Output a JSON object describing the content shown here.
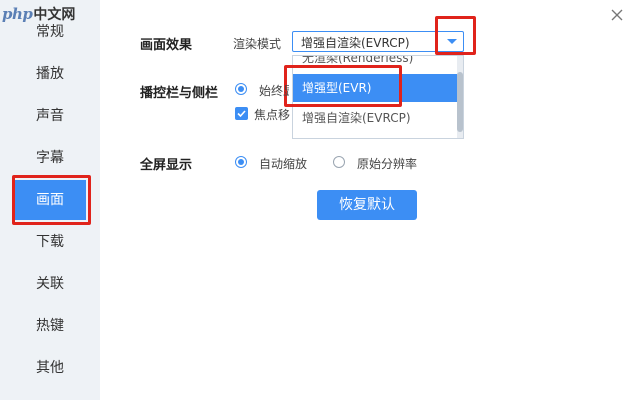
{
  "logo": {
    "php": "php",
    "cn": "中文网"
  },
  "sidebar": {
    "items": [
      {
        "label": "常规"
      },
      {
        "label": "播放"
      },
      {
        "label": "声音"
      },
      {
        "label": "字幕"
      },
      {
        "label": "画面"
      },
      {
        "label": "下载"
      },
      {
        "label": "关联"
      },
      {
        "label": "热键"
      },
      {
        "label": "其他"
      }
    ],
    "active_index": 4
  },
  "picture": {
    "label": "画面效果",
    "render_mode_label": "渲染模式",
    "render_mode_value": "增强自渲染(EVRCP)",
    "options": [
      {
        "label": "无渲染(Renderless)"
      },
      {
        "label": "增强型(EVR)"
      },
      {
        "label": "增强自渲染(EVRCP)"
      }
    ],
    "highlighted_option_index": 1
  },
  "controls": {
    "label": "播控栏与侧栏",
    "radio_label": "始终显",
    "checkbox_label": "焦点移"
  },
  "fullscreen": {
    "label": "全屏显示",
    "options": [
      {
        "label": "自动缩放",
        "selected": true
      },
      {
        "label": "原始分辨率",
        "selected": false
      }
    ]
  },
  "restore_button": {
    "label": "恢复默认"
  },
  "colors": {
    "accent": "#3c8ef4",
    "sidebar_bg": "#eef2f6",
    "highlight": "#e0231b"
  }
}
